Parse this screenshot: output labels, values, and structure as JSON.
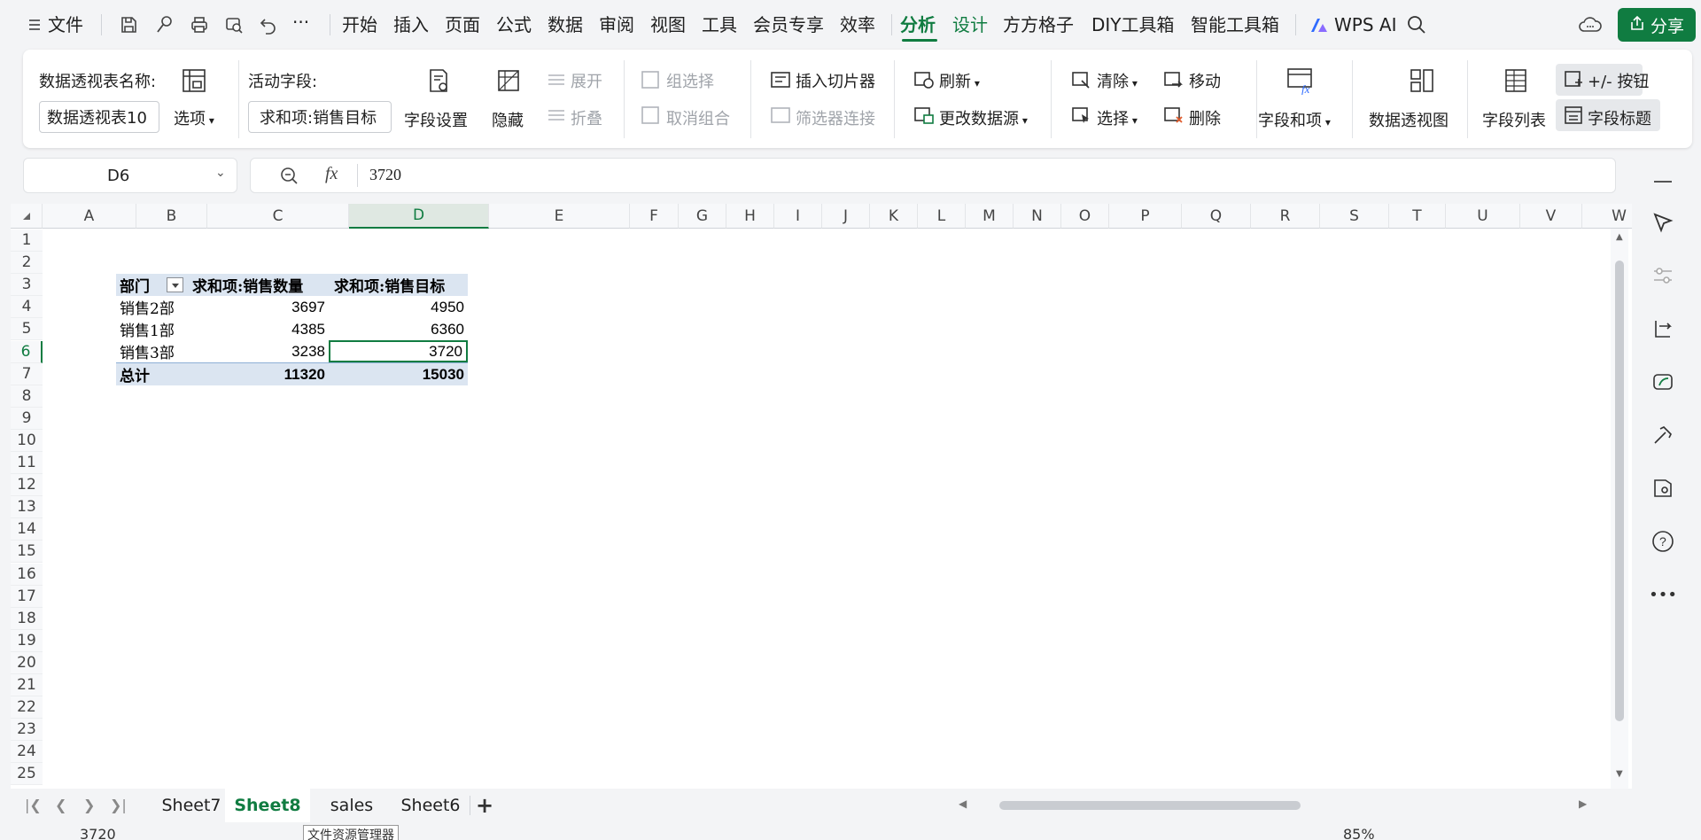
{
  "menubar": {
    "file_label": "文件",
    "tabs": [
      "开始",
      "插入",
      "页面",
      "公式",
      "数据",
      "审阅",
      "视图",
      "工具",
      "会员专享",
      "效率",
      "分析",
      "设计",
      "方方格子",
      "DIY工具箱",
      "智能工具箱"
    ],
    "active_tab": "分析",
    "wps_ai_label": "WPS AI",
    "share_label": "分享",
    "more_label": "···"
  },
  "ribbon": {
    "pivot_name_label": "数据透视表名称:",
    "pivot_name_value": "数据透视表10",
    "options_label": "选项",
    "active_field_label": "活动字段:",
    "active_field_value": "求和项:销售目标",
    "field_settings_label": "字段设置",
    "hide_label": "隐藏",
    "expand_label": "展开",
    "collapse_label": "折叠",
    "group_select_label": "组选择",
    "ungroup_label": "取消组合",
    "insert_slicer_label": "插入切片器",
    "filter_conn_label": "筛选器连接",
    "refresh_label": "刷新",
    "change_source_label": "更改数据源",
    "clear_label": "清除",
    "select_label": "选择",
    "move_label": "移动",
    "delete_label": "删除",
    "fields_items_label": "字段和项",
    "pivot_chart_label": "数据透视图",
    "field_list_label": "字段列表",
    "plusminus_label": "+/- 按钮",
    "field_headers_label": "字段标题"
  },
  "formula_bar": {
    "cell_ref": "D6",
    "fx_label": "fx",
    "value": "3720"
  },
  "grid": {
    "columns": [
      "A",
      "B",
      "C",
      "D",
      "E",
      "F",
      "G",
      "H",
      "I",
      "J",
      "K",
      "L",
      "M",
      "N",
      "O",
      "P",
      "Q",
      "R",
      "S",
      "T",
      "U",
      "V",
      "W"
    ],
    "selected_column": "D",
    "rows": [
      "1",
      "2",
      "3",
      "4",
      "5",
      "6",
      "7",
      "8",
      "9",
      "10",
      "11",
      "12",
      "13",
      "14",
      "15",
      "16",
      "17",
      "18",
      "19",
      "20",
      "21",
      "22",
      "23",
      "24",
      "25"
    ],
    "selected_row": "6"
  },
  "pivot": {
    "headers": [
      "部门",
      "求和项:销售数量",
      "求和项:销售目标"
    ],
    "rows": [
      {
        "dept": "销售2部",
        "qty": "3697",
        "target": "4950"
      },
      {
        "dept": "销售1部",
        "qty": "4385",
        "target": "6360"
      },
      {
        "dept": "销售3部",
        "qty": "3238",
        "target": "3720"
      }
    ],
    "total": {
      "label": "总计",
      "qty": "11320",
      "target": "15030"
    }
  },
  "sheets": {
    "tabs": [
      "Sheet7",
      "Sheet8",
      "sales",
      "Sheet6"
    ],
    "active": "Sheet8",
    "add_label": "+"
  },
  "status": {
    "value": "3720",
    "tooltip": "文件资源管理器",
    "zoom": "85%"
  },
  "colors": {
    "accent": "#107c41",
    "pivot_header_bg": "#dbe5f1"
  }
}
